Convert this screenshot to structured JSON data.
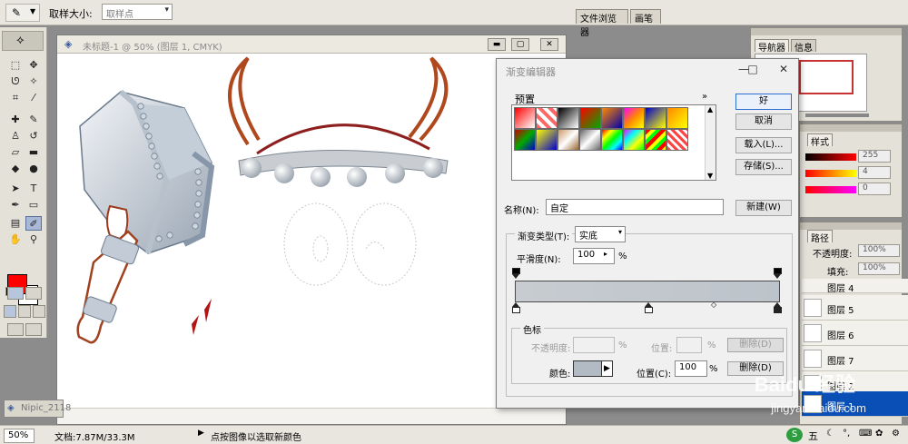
{
  "options_bar": {
    "tool_icon": "eyedropper-icon",
    "sample_size_label": "取样大小:",
    "sample_size_value": "取样点"
  },
  "dock_tabs": [
    "文件浏览器",
    "画笔"
  ],
  "document": {
    "title": "未标题-1 @ 50% (图层 1, CMYK)",
    "minimized_task": "Nipic_2118"
  },
  "status_bar": {
    "zoom": "50%",
    "doc_info": "文档:7.87M/33.3M",
    "message": "点按图像以选取新颜色"
  },
  "navigator_panel": {
    "tabs": [
      "导航器",
      "信息"
    ]
  },
  "color_panel": {
    "tab": "样式",
    "values": [
      "255",
      "4",
      "0"
    ],
    "colors": {
      "foreground": "#ff0000"
    }
  },
  "layers_panel": {
    "tab": "路径",
    "opacity_label": "不透明度:",
    "opacity_value": "100%",
    "fill_label": "填充:",
    "fill_value": "100%",
    "layers": [
      "图层 4",
      "图层 5",
      "图层 6",
      "图层 7",
      "图层 2",
      "图层 1"
    ],
    "selected_layer": "图层 1"
  },
  "gradient_editor": {
    "title": "渐变编辑器",
    "presets_label": "预置",
    "name_label": "名称(N):",
    "name_value": "自定",
    "type_label": "渐变类型(T):",
    "type_value": "实底",
    "smoothness_label": "平滑度(N):",
    "smoothness_value": "100",
    "smoothness_unit": "%",
    "stops_group_label": "色标",
    "opacity_label": "不透明度:",
    "opacity_unit": "%",
    "location_label": "位置:",
    "location_unit": "%",
    "delete_label_1": "删除(D)",
    "color_label": "颜色:",
    "location2_label": "位置(C):",
    "location2_value": "100",
    "location2_unit": "%",
    "delete_label_2": "删除(D)",
    "buttons": {
      "ok": "好",
      "cancel": "取消",
      "load": "载入(L)...",
      "save": "存储(S)...",
      "new": "新建(W)"
    },
    "colors": {
      "gradient_start": "#c8ccd1",
      "gradient_end": "#bcc3ca",
      "stop_color": "#b2bac3"
    }
  },
  "watermark": {
    "text": "Baidu 经验",
    "url": "jingyan.baidu.com"
  },
  "taskbar": {
    "ime": "五"
  }
}
